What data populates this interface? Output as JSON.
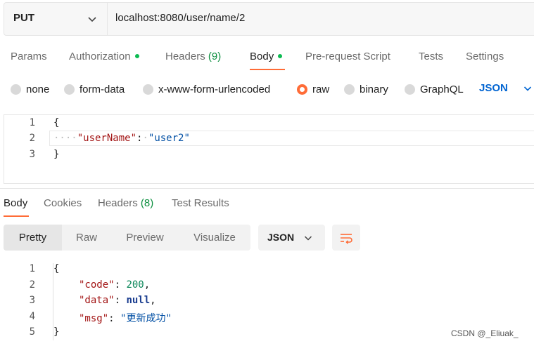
{
  "request": {
    "method": "PUT",
    "url": "localhost:8080/user/name/2"
  },
  "request_tabs": {
    "params": "Params",
    "authorization": "Authorization",
    "headers": "Headers",
    "headers_count": "(9)",
    "body": "Body",
    "prerequest": "Pre-request Script",
    "tests": "Tests",
    "settings": "Settings"
  },
  "body_types": {
    "none": "none",
    "form_data": "form-data",
    "urlencoded": "x-www-form-urlencoded",
    "raw": "raw",
    "binary": "binary",
    "graphql": "GraphQL",
    "selected": "raw",
    "format": "JSON"
  },
  "request_body": {
    "line_numbers": [
      "1",
      "2",
      "3"
    ],
    "open_brace": "{",
    "indent_dots": "····",
    "key": "\"userName\"",
    "colon": ":",
    "value": "\"user2\"",
    "close_brace": "}"
  },
  "response_tabs": {
    "body": "Body",
    "cookies": "Cookies",
    "headers": "Headers",
    "headers_count": "(8)",
    "test_results": "Test Results"
  },
  "response_view": {
    "pretty": "Pretty",
    "raw": "Raw",
    "preview": "Preview",
    "visualize": "Visualize",
    "format": "JSON",
    "active": "Pretty"
  },
  "response_body": {
    "line_numbers": [
      "1",
      "2",
      "3",
      "4",
      "5"
    ],
    "open_brace": "{",
    "code_key": "\"code\"",
    "code_value": "200",
    "data_key": "\"data\"",
    "data_value": "null",
    "msg_key": "\"msg\"",
    "msg_value": "\"更新成功\"",
    "close_brace": "}"
  },
  "watermark": "CSDN @_Eliuak_",
  "colors": {
    "accent": "#ff6c37",
    "active_dot": "#0cbb52",
    "json_select": "#0265d2"
  },
  "icons": [
    "chevron-down-icon",
    "wrap-lines-icon"
  ]
}
